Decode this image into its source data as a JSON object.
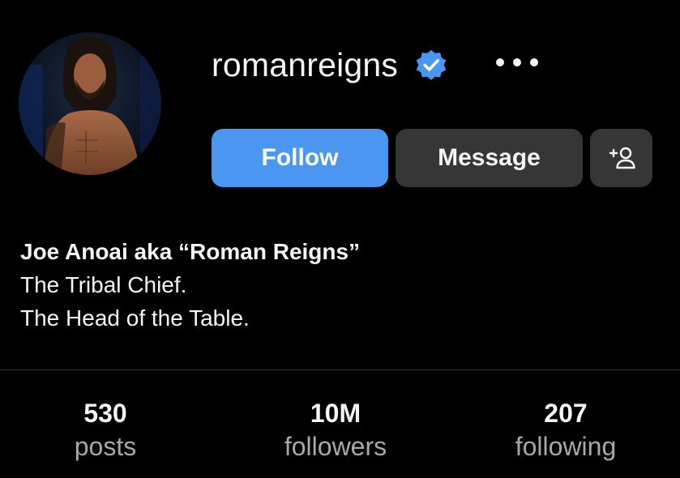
{
  "profile": {
    "username": "romanreigns",
    "verified": true,
    "verified_color": "#4a96f0",
    "avatar_icon": "profile-photo"
  },
  "actions": {
    "follow_label": "Follow",
    "follow_color": "#4a96f0",
    "message_label": "Message",
    "suggest_icon": "add-person-icon",
    "more_icon": "ellipsis-icon"
  },
  "bio": {
    "name": "Joe Anoai aka “Roman Reigns”",
    "lines": [
      "The Tribal Chief.",
      "The Head of the Table."
    ]
  },
  "stats": [
    {
      "value": "530",
      "label": "posts"
    },
    {
      "value": "10M",
      "label": "followers"
    },
    {
      "value": "207",
      "label": "following"
    }
  ]
}
